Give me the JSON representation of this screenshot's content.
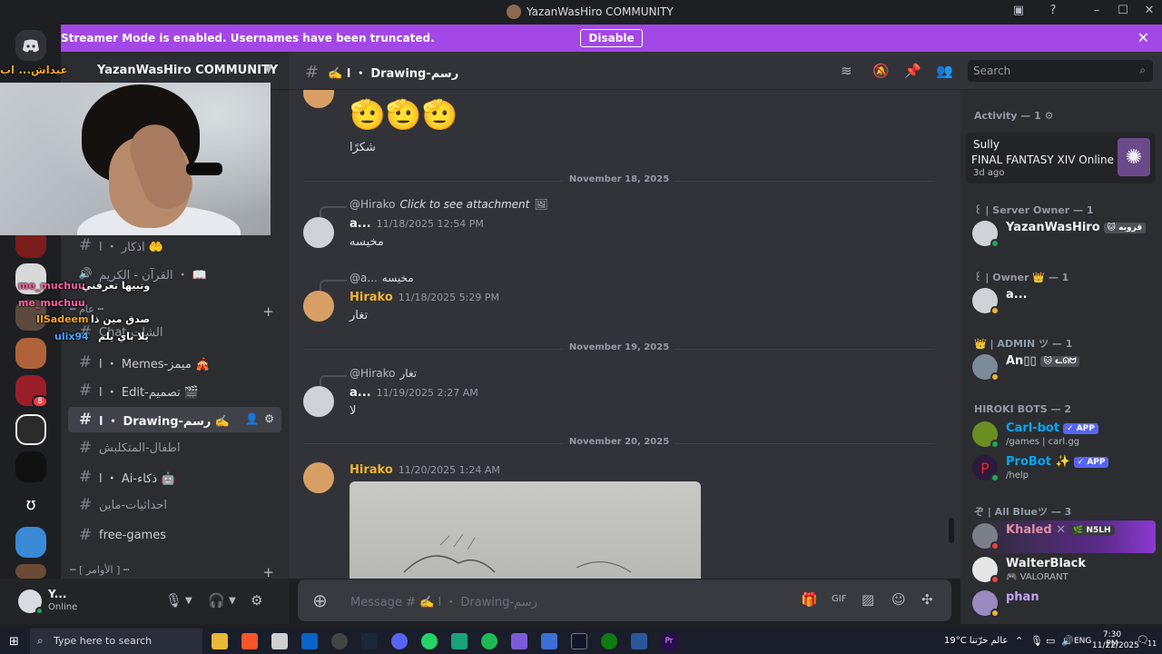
{
  "window": {
    "title": "YazanWasHiro COMMUNITY"
  },
  "banner": {
    "message": "Streamer Mode is enabled. Usernames have been truncated.",
    "disable_label": "Disable"
  },
  "server": {
    "name": "YazanWasHiro COMMUNITY"
  },
  "stream_overlay": {
    "top_text": "عبداش... اب",
    "lines": [
      {
        "name": "me_muchuu",
        "text": "وتبيها تعرفني"
      },
      {
        "name": "me_muchuu",
        "text": ""
      },
      {
        "name": "IlSadeem",
        "text": "صدق مين ذا"
      },
      {
        "name": "ulix94",
        "text": "يلا باي يلم"
      }
    ]
  },
  "channels": [
    {
      "name": "اذكار ・ ا 🤲",
      "type": "text"
    },
    {
      "name": "القرآن - الكريم ・ 📖",
      "type": "voice"
    },
    {
      "name": "Chat-الشات",
      "type": "text"
    },
    {
      "name": "ا ・ Memes-ميمز 🎪",
      "type": "text"
    },
    {
      "name": "ا ・ Edit-تصميم 🎬",
      "type": "text"
    },
    {
      "name": "ا ・ Drawing-رسم ✍️",
      "type": "text",
      "selected": true
    },
    {
      "name": "اطفال-المتكلبش",
      "type": "text"
    },
    {
      "name": "ا ・ Ai-ذكاء 🤖",
      "type": "text"
    },
    {
      "name": "احداثيات-ماين",
      "type": "text"
    },
    {
      "name": "free-games",
      "type": "text"
    }
  ],
  "categories": [
    {
      "label": "┅ عام ┅"
    },
    {
      "label": "┅ [ الأوامر ] ┅"
    }
  ],
  "user_panel": {
    "name": "Y...",
    "status": "Online"
  },
  "channel_header": {
    "name": "✍️ ا ・ Drawing-رسم",
    "search_placeholder": "Search"
  },
  "messages": [
    {
      "text": "شكرًا",
      "emoji": "🫡🫡🫡"
    },
    {
      "divider": "November 18, 2025"
    },
    {
      "reply_to": "@Hirako",
      "reply_text": "Click to see attachment",
      "author": "a...",
      "time": "11/18/2025 12:54 PM",
      "text": "مخيسه"
    },
    {
      "reply_to": "@a...",
      "reply_text": "مخيسه",
      "author": "Hirako",
      "time": "11/18/2025 5:29 PM",
      "text": "تغار"
    },
    {
      "divider": "November 19, 2025"
    },
    {
      "reply_to": "@Hirako",
      "reply_text": "تغار",
      "author": "a...",
      "time": "11/19/2025 2:27 AM",
      "text": "لا"
    },
    {
      "divider": "November 20, 2025"
    },
    {
      "author": "Hirako",
      "time": "11/20/2025 1:24 AM",
      "text": ""
    }
  ],
  "composer": {
    "placeholder": "Message # ✍️ ا ・ Drawing-رسم"
  },
  "members": {
    "activity_header": "Activity — 1 ⚙",
    "activity": {
      "user": "Sully",
      "game": "FINAL FANTASY XIV Online",
      "time": "3d ago"
    },
    "groups": [
      {
        "title": "꒰ | Server Owner — 1",
        "members": [
          {
            "name": "YazanWasHiro",
            "tag": "🐱 قروبه",
            "color": "#f2f3f5"
          }
        ]
      },
      {
        "title": "꒰ | Owner 👑 — 1",
        "members": [
          {
            "name": "a...",
            "color": "#f2f3f5"
          }
        ]
      },
      {
        "title": "👑 | ADMIN ツ — 1",
        "members": [
          {
            "name": "An▯▯",
            "tag": "🐱 ᓚᘏᗢ",
            "color": "#f2f3f5"
          }
        ]
      },
      {
        "title": "HIROKI BOTS — 2",
        "members": [
          {
            "name": "Carl-bot",
            "tag": "✓ APP",
            "sub": "/games | carl.gg",
            "color": "#00a8fc"
          },
          {
            "name": "ProBot ✨",
            "tag": "✓ APP",
            "sub": "/help",
            "color": "#00a8fc"
          }
        ]
      },
      {
        "title": "ぞ | All Blueツ — 3",
        "members": [
          {
            "name": "Khaled",
            "tag": "🌿 N5LH",
            "color": "#e28fa6"
          },
          {
            "name": "WalterBlack",
            "sub": "🎮 VALORANT",
            "color": "#f2f3f5"
          },
          {
            "name": "phan",
            "color": "#c3a3f5"
          }
        ]
      }
    ]
  },
  "taskbar": {
    "search_placeholder": "Type here to search",
    "weather": "19°C عالم حرّتنا",
    "lang": "ENG",
    "time": "7:30 PM",
    "date": "11/22/2025",
    "notif_count": "11"
  },
  "colors": {
    "accent": "#5865f2",
    "banner": "#a347e6",
    "online": "#23a559"
  }
}
